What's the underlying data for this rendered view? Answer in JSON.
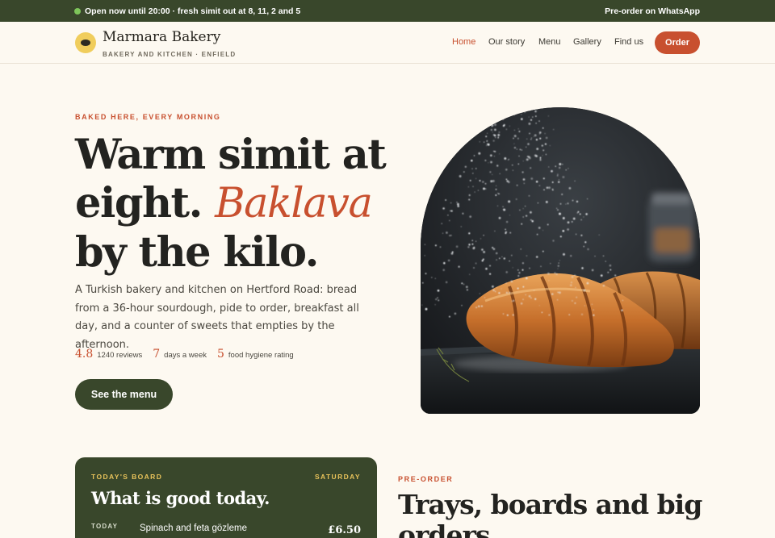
{
  "topbar": {
    "status_text": "Open now until 20:00 · fresh simit out at 8, 11, 2 and 5",
    "status_dot_color": "#7ec55a",
    "whatsapp_link": "Pre-order on WhatsApp",
    "background": "#39472b"
  },
  "header": {
    "brand": "Marmara Bakery",
    "tagline": "BAKERY AND KITCHEN · ENFIELD",
    "logo_icon": "simit-logo-icon",
    "nav": [
      "Home",
      "Our story",
      "Menu",
      "Gallery",
      "Find us"
    ],
    "active_nav": "Home",
    "order_button": "Order"
  },
  "hero": {
    "eyebrow": "BAKED HERE, EVERY MORNING",
    "headline_part1": "Warm simit at eight. ",
    "headline_accent": "Baklava",
    "headline_part2": " by the kilo.",
    "lead": "A Turkish bakery and kitchen on Hertford Road: bread from a 36-hour sourdough, pide to order, breakfast all day, and a counter of sweets that empties by the afternoon.",
    "stats": [
      {
        "num": "4.8",
        "label": "1240 reviews"
      },
      {
        "num": "7",
        "label": "days a week"
      },
      {
        "num": "5",
        "label": "food hygiene rating"
      }
    ],
    "cta": "See the menu",
    "image": "croissants-dusted-with-sugar-photo"
  },
  "board": {
    "eyebrow": "TODAY'S BOARD",
    "day": "SATURDAY",
    "title": "What is good today.",
    "rows": [
      {
        "when": "TODAY",
        "item": "Spinach and feta gözleme",
        "price": "£6.50"
      }
    ]
  },
  "preorder": {
    "eyebrow": "PRE-ORDER",
    "title": "Trays, boards and big orders"
  },
  "colors": {
    "accent": "#c8502f",
    "forest": "#39472b",
    "cream": "#fdf9f1",
    "mustard": "#f0cd5c"
  }
}
